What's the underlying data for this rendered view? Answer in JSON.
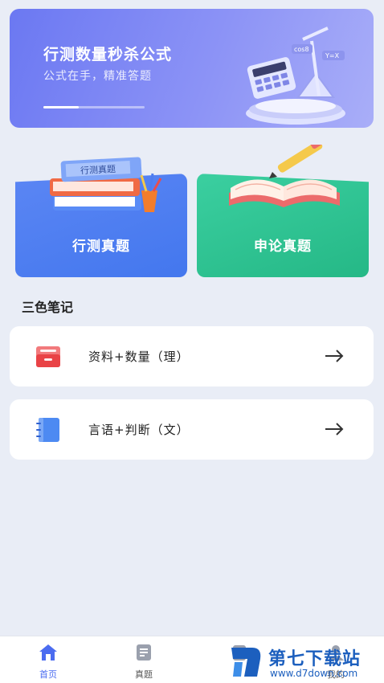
{
  "banner": {
    "title": "行测数量秒杀公式",
    "subtitle": "公式在手，精准答题",
    "art_labels": [
      "cos8",
      "Y=X"
    ]
  },
  "categories": [
    {
      "label": "行测真题",
      "color": "#4a7cf0",
      "book_text": "行测真题"
    },
    {
      "label": "申论真题",
      "color": "#2bc08f"
    }
  ],
  "section": {
    "title": "三色笔记"
  },
  "notes": [
    {
      "label": "资料+数量（理）",
      "icon": "red-folder-icon",
      "color": "#ef5457"
    },
    {
      "label": "言语+判断（文）",
      "icon": "blue-notebook-icon",
      "color": "#4d8af2"
    }
  ],
  "tabbar": {
    "items": [
      {
        "label": "首页",
        "icon": "home-icon",
        "active": true
      },
      {
        "label": "真题",
        "icon": "document-icon",
        "active": false
      },
      {
        "label": "",
        "icon": "notes-icon",
        "active": false
      },
      {
        "label": "我的",
        "icon": "profile-icon",
        "active": false
      }
    ]
  },
  "watermark": {
    "title": "第七下载站",
    "url": "www.d7down.com"
  },
  "colors": {
    "accent": "#4b6cf0",
    "background": "#e9edf6"
  }
}
